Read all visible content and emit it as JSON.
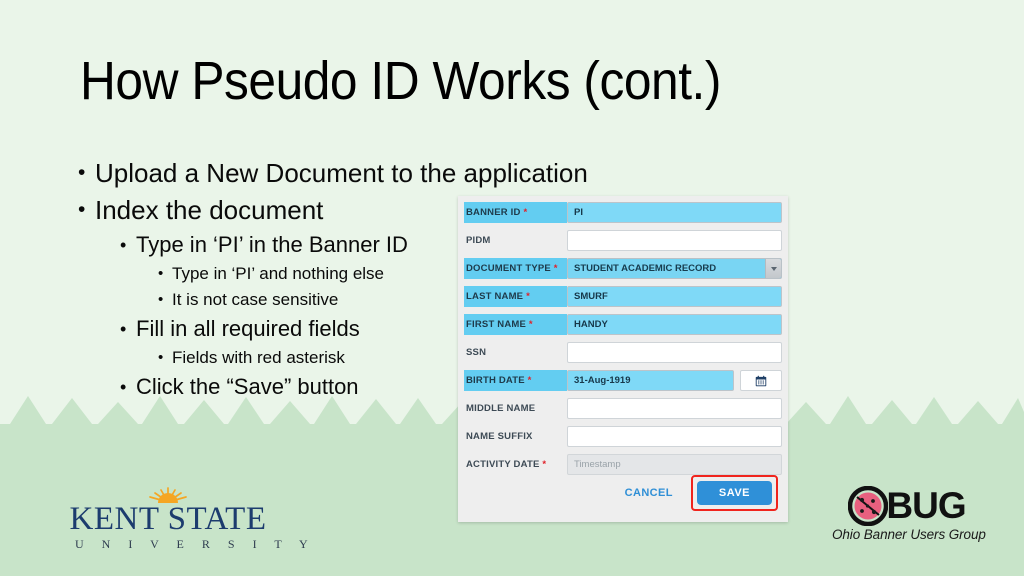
{
  "slide": {
    "title": "How Pseudo ID Works (cont.)",
    "background_color": "#eaf5e9",
    "tree_band_color": "#c8e4c9"
  },
  "bullets": [
    {
      "level": 1,
      "text": "Upload a New Document to the application"
    },
    {
      "level": 1,
      "text": "Index the document"
    },
    {
      "level": 2,
      "text": "Type in ‘PI’ in the Banner ID"
    },
    {
      "level": 3,
      "text": "Type in ‘PI’ and nothing else"
    },
    {
      "level": 3,
      "text": "It is not case sensitive"
    },
    {
      "level": 2,
      "text": "Fill in all required fields"
    },
    {
      "level": 3,
      "text": "Fields with red asterisk"
    },
    {
      "level": 2,
      "text": "Click the “Save” button"
    }
  ],
  "form": {
    "required_marker": "*",
    "highlight_color": "#63cdf1",
    "required_color": "#e0222a",
    "fields": [
      {
        "label": "BANNER ID",
        "required": true,
        "highlighted": true,
        "value": "PI",
        "placeholder": "",
        "type": "text",
        "has_calendar": false
      },
      {
        "label": "PIDM",
        "required": false,
        "highlighted": false,
        "value": "",
        "placeholder": "",
        "type": "text",
        "has_calendar": false
      },
      {
        "label": "DOCUMENT TYPE",
        "required": true,
        "highlighted": true,
        "value": "STUDENT ACADEMIC RECORD",
        "placeholder": "",
        "type": "select",
        "has_calendar": false
      },
      {
        "label": "LAST NAME",
        "required": true,
        "highlighted": true,
        "value": "SMURF",
        "placeholder": "",
        "type": "text",
        "has_calendar": false
      },
      {
        "label": "FIRST NAME",
        "required": true,
        "highlighted": true,
        "value": "HANDY",
        "placeholder": "",
        "type": "text",
        "has_calendar": false
      },
      {
        "label": "SSN",
        "required": false,
        "highlighted": false,
        "value": "",
        "placeholder": "",
        "type": "text",
        "has_calendar": false
      },
      {
        "label": "BIRTH DATE",
        "required": true,
        "highlighted": true,
        "value": "31-Aug-1919",
        "placeholder": "",
        "type": "date",
        "has_calendar": true
      },
      {
        "label": "MIDDLE NAME",
        "required": false,
        "highlighted": false,
        "value": "",
        "placeholder": "",
        "type": "text",
        "has_calendar": false
      },
      {
        "label": "NAME SUFFIX",
        "required": false,
        "highlighted": false,
        "value": "",
        "placeholder": "",
        "type": "text",
        "has_calendar": false
      },
      {
        "label": "ACTIVITY DATE",
        "required": true,
        "highlighted": false,
        "value": "",
        "placeholder": "Timestamp",
        "type": "disabled",
        "has_calendar": false
      }
    ],
    "cancel_label": "CANCEL",
    "save_label": "SAVE",
    "save_highlight_color": "#f0241d",
    "save_button_color": "#2f90d8"
  },
  "logos": {
    "kent_state": {
      "name": "KENT STATE",
      "subtitle": "U N I V E R S I T Y",
      "navy": "#1c3c6e",
      "sun": "#f5a623"
    },
    "obug": {
      "letters": "OBUG",
      "tagline": "Ohio Banner Users Group",
      "ladybug_color": "#e8607f"
    }
  }
}
